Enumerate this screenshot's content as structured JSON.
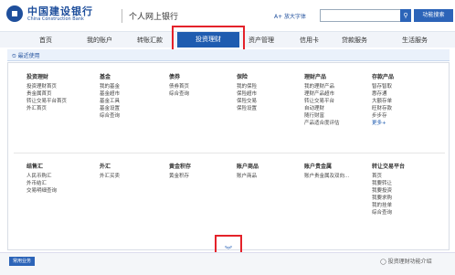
{
  "header": {
    "bank_name_cn": "中国建设银行",
    "bank_name_en": "China Construction Bank",
    "site_title": "个人网上银行",
    "font_size_label": "A+ 放大字体",
    "search_placeholder": "",
    "search_icon": "⚲",
    "func_search_label": "功能搜索"
  },
  "nav": {
    "items": [
      "首页",
      "我的账户",
      "转账汇款",
      "投资理财",
      "资产管理",
      "信用卡",
      "贷款服务",
      "生活服务"
    ],
    "active_index": 3
  },
  "recent": {
    "label": "最近使用"
  },
  "panel": {
    "row1": [
      {
        "title": "投资理财",
        "items": [
          "投资理财首页",
          "贵金属首页",
          "转让交易平台首页",
          "外汇首页"
        ]
      },
      {
        "title": "基金",
        "items": [
          "我的基金",
          "基金超市",
          "基金工具",
          "基金设置",
          "综合查询"
        ]
      },
      {
        "title": "债券",
        "items": [
          "债券首页",
          "综合查询"
        ]
      },
      {
        "title": "保险",
        "items": [
          "我的保险",
          "保险超市",
          "保险交易",
          "保险设置"
        ]
      },
      {
        "title": "理财产品",
        "items": [
          "我的理财产品",
          "理财产品超市",
          "转让交易平台",
          "自动理财",
          "随行财富",
          "产品适合度评估"
        ]
      },
      {
        "title": "存款产品",
        "items": [
          "智存智取",
          "惠存通",
          "大额存单",
          "旺财存款",
          "步步存",
          "更多+"
        ]
      }
    ],
    "row2": [
      {
        "title": "结售汇",
        "items": [
          "人民币购汇",
          "外币结汇",
          "交易明细查询"
        ]
      },
      {
        "title": "外汇",
        "items": [
          "外汇买卖"
        ]
      },
      {
        "title": "黄金积存",
        "items": [
          "黄金积存"
        ]
      },
      {
        "title": "账户商品",
        "items": [
          "账户商品"
        ]
      },
      {
        "title": "账户贵金属",
        "items": [
          "账户贵金属及双向..."
        ]
      },
      {
        "title": "转让交易平台",
        "items": [
          "首页",
          "我要转让",
          "我要投资",
          "我要求购",
          "我的挂单",
          "综合查询"
        ]
      }
    ]
  },
  "expand_icon": "︾",
  "footer": {
    "left_button": "常用业务",
    "right_text": "◯ 投资理财功能介绍"
  }
}
